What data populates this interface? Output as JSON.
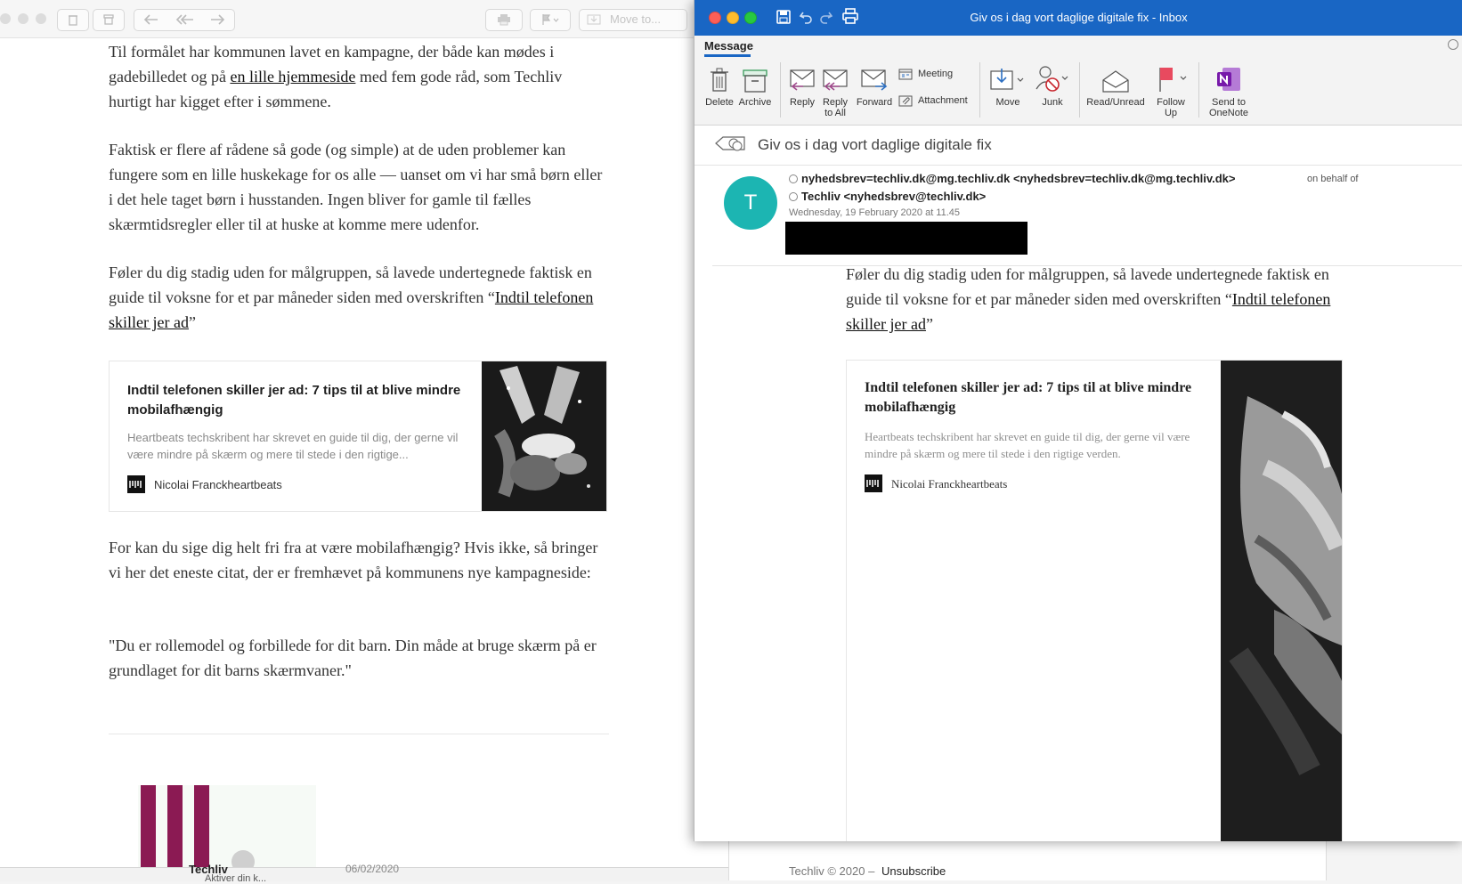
{
  "apple_mail": {
    "toolbar": {
      "move_to_label": "Move to..."
    },
    "article": {
      "p1_text1": "Til formålet har kommunen lavet en kampagne, der både kan mødes i gadebilledet og på ",
      "p1_link": "en lille hjemmeside",
      "p1_text2": " med fem gode råd, som Techliv hurtigt har kigget efter i sømmene.",
      "p2": "Faktisk er flere af rådene så gode (og simple) at de uden problemer kan fungere som en lille huskekage for os alle — uanset om vi har små børn eller i det hele taget børn i husstanden. Ingen bliver for gamle til fælles skærmtidsregler eller til at huske at komme mere udenfor.",
      "p3_text": "Føler du dig stadig uden for målgruppen, så lavede undertegnede faktisk en guide til voksne for et par måneder siden med overskriften ",
      "p3_quote_open": "“",
      "p3_link": "Indtil telefonen skiller jer ad",
      "p3_quote_close": "”",
      "card": {
        "title": "Indtil telefonen skiller jer ad: 7 tips til at blive mindre mobilafhængig",
        "description": "Heartbeats techskribent har skrevet en guide til dig, der gerne vil være mindre på skærm og mere til stede i den rigtige...",
        "author": "Nicolai Franckheartbeats"
      },
      "p4": "For kan du sige dig helt fri fra at være mobilafhængig? Hvis ikke, så bringer vi her det eneste citat, der er fremhævet på kommunens nye kampagneside:",
      "p5": "\"Du er rollemodel og forbillede for dit barn. Din måde at bruge skærm på er grundlaget for dit barns skærmvaner.\""
    },
    "bottom_list": {
      "sender": "Techliv",
      "date": "06/02/2020",
      "preview": "Aktiver din k..."
    }
  },
  "outlook": {
    "window_title": "Giv os i dag vort daglige digitale fix - Inbox",
    "ribbon_tab": "Message",
    "ribbon": {
      "delete": "Delete",
      "archive": "Archive",
      "reply": "Reply",
      "reply_all_1": "Reply",
      "reply_all_2": "to All",
      "forward": "Forward",
      "meeting": "Meeting",
      "attachment": "Attachment",
      "move": "Move",
      "junk": "Junk",
      "read_unread": "Read/Unread",
      "follow_up_1": "Follow",
      "follow_up_2": "Up",
      "onenote_1": "Send to",
      "onenote_2": "OneNote"
    },
    "subject": "Giv os i dag vort daglige digitale fix",
    "header": {
      "avatar_initial": "T",
      "from": "nyhedsbrev=techliv.dk@mg.techliv.dk <nyhedsbrev=techliv.dk@mg.techliv.dk>",
      "on_behalf": "on behalf of",
      "sender": "Techliv <nyhedsbrev@techliv.dk>",
      "date": "Wednesday, 19 February 2020 at 11.45"
    },
    "body": {
      "p1_text": "Føler du dig stadig uden for målgruppen, så lavede undertegnede faktisk en guide til voksne for et par måneder siden med overskriften ",
      "quote_open": "“",
      "link": "Indtil telefonen skiller jer ad",
      "quote_close": "”",
      "card": {
        "title": "Indtil telefonen skiller jer ad: 7 tips til at blive mindre mobilafhængig",
        "description": "Heartbeats techskribent har skrevet en guide til dig, der gerne vil være mindre på skærm og mere til stede i den rigtige verden.",
        "author": "Nicolai Franckheartbeats"
      }
    },
    "footer": {
      "copyright": "Techliv © 2020 –",
      "unsubscribe": "Unsubscribe"
    }
  }
}
